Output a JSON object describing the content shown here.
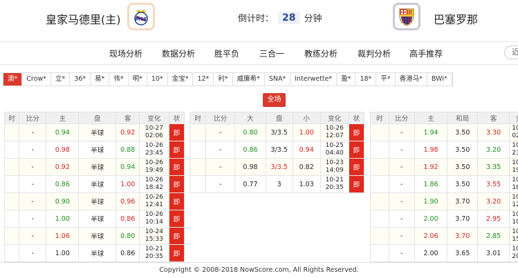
{
  "match": {
    "home_team": "皇家马德里(主)",
    "away_team": "巴塞罗那",
    "countdown_label": "倒计时：",
    "countdown_value": "28",
    "countdown_unit": "分钟"
  },
  "nav": {
    "items": [
      "现场分析",
      "数据分析",
      "胜平负",
      "三合一",
      "教练分析",
      "裁判分析",
      "高手推荐"
    ],
    "more_label": "近"
  },
  "company_tabs": [
    "澳*",
    "Crow*",
    "立*",
    "36*",
    "易*",
    "伟*",
    "明*",
    "10*",
    "金宝*",
    "12*",
    "利*",
    "威廉希*",
    "SNA*",
    "Interwette*",
    "盈*",
    "18*",
    "平*",
    "香港马*",
    "BWi*"
  ],
  "active_company_index": 0,
  "full_match_label": "全场",
  "asian": {
    "headers": [
      "时",
      "比分",
      "主",
      "盘",
      "客",
      "变化",
      "状"
    ],
    "rows": [
      {
        "time": "",
        "score": "-",
        "home": "0.94",
        "home_c": "g",
        "line": "半球",
        "away": "0.92",
        "away_c": "r",
        "d1": "10-27",
        "d2": "02:06",
        "status": "即"
      },
      {
        "time": "",
        "score": "-",
        "home": "0.98",
        "home_c": "r",
        "line": "半球",
        "away": "0.88",
        "away_c": "g",
        "d1": "10-26",
        "d2": "23:45",
        "status": "即"
      },
      {
        "time": "",
        "score": "-",
        "home": "0.92",
        "home_c": "r",
        "line": "半球",
        "away": "0.94",
        "away_c": "g",
        "d1": "10-26",
        "d2": "19:49",
        "status": "即"
      },
      {
        "time": "",
        "score": "-",
        "home": "0.86",
        "home_c": "g",
        "line": "半球",
        "away": "1.00",
        "away_c": "r",
        "d1": "10-26",
        "d2": "18:42",
        "status": "即"
      },
      {
        "time": "",
        "score": "-",
        "home": "0.90",
        "home_c": "g",
        "line": "半球",
        "away": "0.96",
        "away_c": "r",
        "d1": "10-26",
        "d2": "12:41",
        "status": "即"
      },
      {
        "time": "",
        "score": "-",
        "home": "1.00",
        "home_c": "g",
        "line": "半球",
        "away": "0.86",
        "away_c": "r",
        "d1": "10-26",
        "d2": "10:14",
        "status": "即"
      },
      {
        "time": "",
        "score": "-",
        "home": "1.06",
        "home_c": "r",
        "line": "半球",
        "away": "0.80",
        "away_c": "g",
        "d1": "10-24",
        "d2": "15:33",
        "status": "即"
      },
      {
        "time": "",
        "score": "-",
        "home": "1.00",
        "home_c": "k",
        "line": "半球",
        "away": "0.86",
        "away_c": "k",
        "d1": "10-21",
        "d2": "20:35",
        "status": "即"
      }
    ]
  },
  "overunder": {
    "headers": [
      "时",
      "比分",
      "大",
      "盘",
      "小",
      "变化",
      "状"
    ],
    "rows": [
      {
        "time": "",
        "score": "-",
        "over": "0.80",
        "over_c": "g",
        "line": "3/3.5",
        "line_c": "k",
        "under": "1.00",
        "under_c": "r",
        "d1": "10-26",
        "d2": "12:07",
        "status": "即"
      },
      {
        "time": "",
        "score": "-",
        "over": "0.86",
        "over_c": "g",
        "line": "3/3.5",
        "line_c": "k",
        "under": "0.94",
        "under_c": "r",
        "d1": "10-25",
        "d2": "04:40",
        "status": "即"
      },
      {
        "time": "",
        "score": "-",
        "over": "0.98",
        "over_c": "k",
        "line": "3/3.5",
        "line_c": "r",
        "under": "0.82",
        "under_c": "k",
        "d1": "10-23",
        "d2": "14:09",
        "status": "即"
      },
      {
        "time": "",
        "score": "-",
        "over": "0.77",
        "over_c": "k",
        "line": "3",
        "line_c": "k",
        "under": "1.03",
        "under_c": "k",
        "d1": "10-21",
        "d2": "20:35",
        "status": "即"
      }
    ]
  },
  "europe": {
    "headers": [
      "时",
      "比分",
      "主",
      "和局",
      "客",
      "变"
    ],
    "rows": [
      {
        "time": "",
        "score": "-",
        "home": "1.94",
        "home_c": "g",
        "draw": "3.50",
        "draw_c": "k",
        "away": "3.30",
        "away_c": "r",
        "d1": "10-2",
        "d2": "02:0"
      },
      {
        "time": "",
        "score": "-",
        "home": "1.98",
        "home_c": "r",
        "draw": "3.50",
        "draw_c": "k",
        "away": "3.20",
        "away_c": "g",
        "d1": "10-2",
        "d2": "23:4"
      },
      {
        "time": "",
        "score": "-",
        "home": "1.92",
        "home_c": "r",
        "draw": "3.50",
        "draw_c": "k",
        "away": "3.35",
        "away_c": "g",
        "d1": "10-2",
        "d2": "19:4"
      },
      {
        "time": "",
        "score": "-",
        "home": "1.86",
        "home_c": "g",
        "draw": "3.50",
        "draw_c": "k",
        "away": "3.55",
        "away_c": "r",
        "d1": "10-2",
        "d2": "18:4"
      },
      {
        "time": "",
        "score": "-",
        "home": "1.90",
        "home_c": "g",
        "draw": "3.70",
        "draw_c": "k",
        "away": "3.20",
        "away_c": "r",
        "d1": "10-2",
        "d2": "12:4"
      },
      {
        "time": "",
        "score": "-",
        "home": "2.00",
        "home_c": "g",
        "draw": "3.70",
        "draw_c": "k",
        "away": "2.95",
        "away_c": "r",
        "d1": "10-2",
        "d2": "10:1"
      },
      {
        "time": "",
        "score": "-",
        "home": "2.06",
        "home_c": "r",
        "draw": "3.70",
        "draw_c": "r",
        "away": "2.85",
        "away_c": "g",
        "d1": "10-2",
        "d2": "15:3"
      },
      {
        "time": "",
        "score": "-",
        "home": "2.00",
        "home_c": "k",
        "draw": "3.65",
        "draw_c": "k",
        "away": "3.01",
        "away_c": "k",
        "d1": "10-2",
        "d2": "20:3"
      }
    ]
  },
  "footer": "Copyright © 2008-2018 NowScore.com, All Rights Reserved.",
  "colors": {
    "accent_red": "#d93a2b",
    "up_red": "#d42020",
    "down_green": "#1a8f1a"
  }
}
